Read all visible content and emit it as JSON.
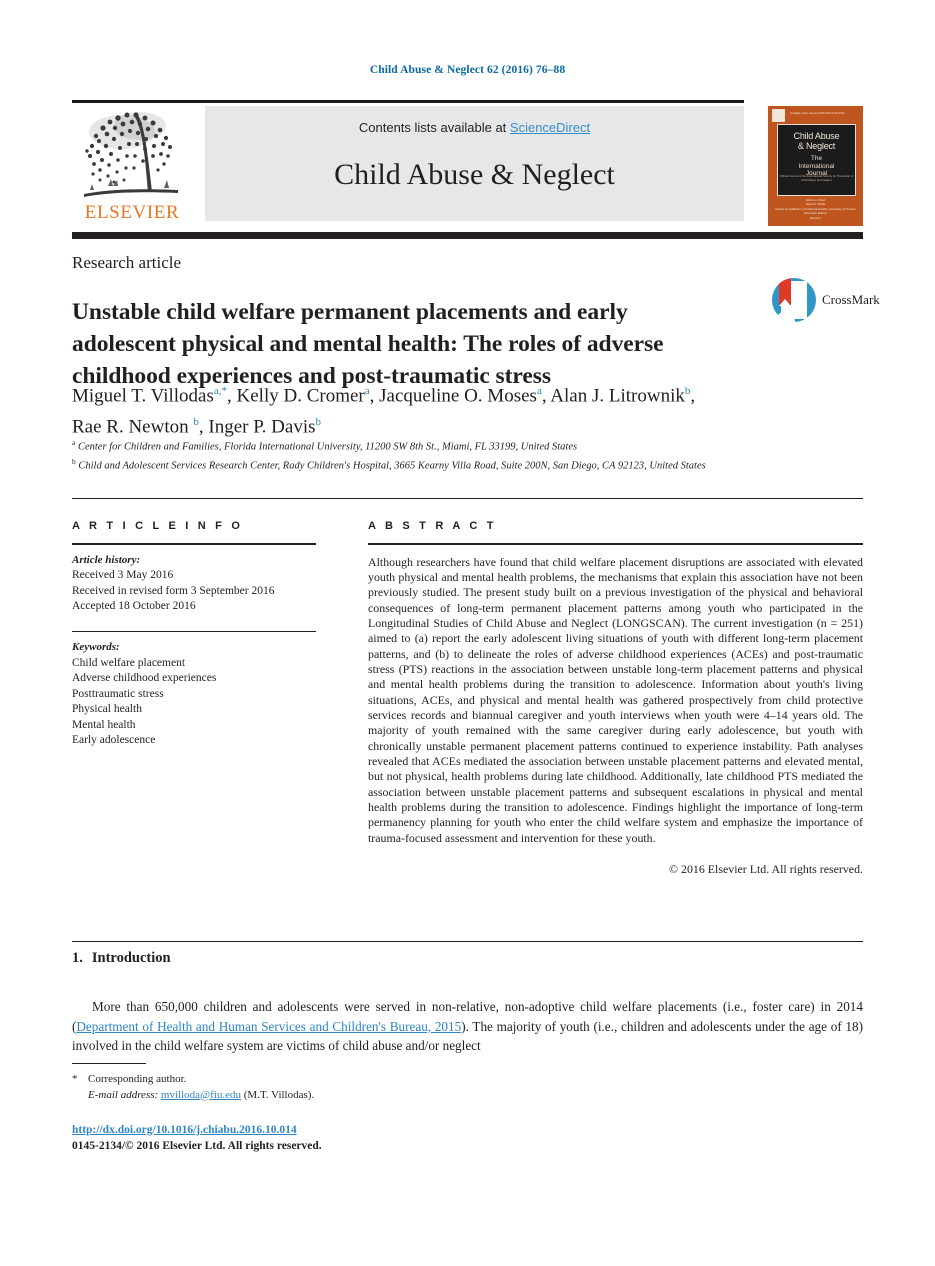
{
  "running_head": "Child Abuse & Neglect 62 (2016) 76–88",
  "masthead": {
    "elsevier_wordmark": "ELSEVIER",
    "contents_prefix": "Contents lists available at ",
    "contents_link": "ScienceDirect",
    "journal_name": "Child Abuse & Neglect",
    "cover": {
      "top_left_mark": "ELSEVIER",
      "top_strip": "Available online January 2016          ISSN 0145-2134",
      "line1": "Child Abuse",
      "line2": "& Neglect",
      "line3": "The",
      "line4": "International",
      "line5": "Journal",
      "line6": "Official Journal of the International Society for Prevention of Child Abuse and Neglect",
      "footer1": "Editor-in-Chief",
      "footer2": "David A. Wolfe",
      "footer3": "Centre for Addiction and Mental Health, University of Toronto",
      "footer4": "Associate Editors",
      "footer5": "Elsevier"
    }
  },
  "article": {
    "category": "Research article",
    "title": "Unstable child welfare permanent placements and early adolescent physical and mental health: The roles of adverse childhood experiences and post-traumatic stress",
    "crossmark_label": "CrossMark",
    "authors_html": "Miguel T. Villodas<sup>a</sup><sup class=\"star\">,*</sup>, Kelly D. Cromer<sup>a</sup>, Jacqueline O. Moses<sup>a</sup>, Alan J. Litrownik<sup>b</sup>, Rae R. Newton <sup>b</sup>, Inger P. Davis<sup>b</sup>",
    "affiliations": [
      {
        "marker": "a",
        "text": "Center for Children and Families, Florida International University, 11200 SW 8th St., Miami, FL 33199, United States"
      },
      {
        "marker": "b",
        "text": "Child and Adolescent Services Research Center, Rady Children's Hospital, 3665 Kearny Villa Road, Suite 200N, San Diego, CA 92123, United States"
      }
    ]
  },
  "article_info": {
    "heading": "A R T I C L E   I N F O",
    "history_label": "Article history:",
    "history": [
      "Received 3 May 2016",
      "Received in revised form 3 September 2016",
      "Accepted 18 October 2016"
    ],
    "keywords_label": "Keywords:",
    "keywords": [
      "Child welfare placement",
      "Adverse childhood experiences",
      "Posttraumatic stress",
      "Physical health",
      "Mental health",
      "Early adolescence"
    ]
  },
  "abstract": {
    "heading": "A B S T R A C T",
    "body": "Although researchers have found that child welfare placement disruptions are associated with elevated youth physical and mental health problems, the mechanisms that explain this association have not been previously studied. The present study built on a previous investigation of the physical and behavioral consequences of long-term permanent placement patterns among youth who participated in the Longitudinal Studies of Child Abuse and Neglect (LONGSCAN). The current investigation (n = 251) aimed to (a) report the early adolescent living situations of youth with different long-term placement patterns, and (b) to delineate the roles of adverse childhood experiences (ACEs) and post-traumatic stress (PTS) reactions in the association between unstable long-term placement patterns and physical and mental health problems during the transition to adolescence. Information about youth's living situations, ACEs, and physical and mental health was gathered prospectively from child protective services records and biannual caregiver and youth interviews when youth were 4–14 years old. The majority of youth remained with the same caregiver during early adolescence, but youth with chronically unstable permanent placement patterns continued to experience instability. Path analyses revealed that ACEs mediated the association between unstable placement patterns and elevated mental, but not physical, health problems during late childhood. Additionally, late childhood PTS mediated the association between unstable placement patterns and subsequent escalations in physical and mental health problems during the transition to adolescence. Findings highlight the importance of long-term permanency planning for youth who enter the child welfare system and emphasize the importance of trauma-focused assessment and intervention for these youth.",
    "copyright": "© 2016 Elsevier Ltd. All rights reserved."
  },
  "introduction": {
    "number": "1.",
    "heading": "Introduction",
    "paragraph_part1": "More than 650,000 children and adolescents were served in non-relative, non-adoptive child welfare placements (i.e., foster care) in 2014 (",
    "citation": "Department of Health and Human Services and Children's Bureau, 2015",
    "paragraph_part2": "). The majority of youth (i.e., children and adolescents under the age of 18) involved in the child welfare system are victims of child abuse and/or neglect"
  },
  "footnote": {
    "star": "*",
    "corresponding": "Corresponding author.",
    "email_label": "E-mail address:",
    "email": "mvilloda@fiu.edu",
    "email_suffix": "(M.T. Villodas).",
    "doi": "http://dx.doi.org/10.1016/j.chiabu.2016.10.014",
    "issn_line": "0145-2134/© 2016 Elsevier Ltd. All rights reserved."
  },
  "colors": {
    "link_blue": "#2f86c5",
    "running_head_blue": "#0b6aa2",
    "elsevier_orange": "#e87722",
    "cover_orange": "#c0561f",
    "band_black": "#231f20",
    "grey_box": "#e6e7e8"
  }
}
